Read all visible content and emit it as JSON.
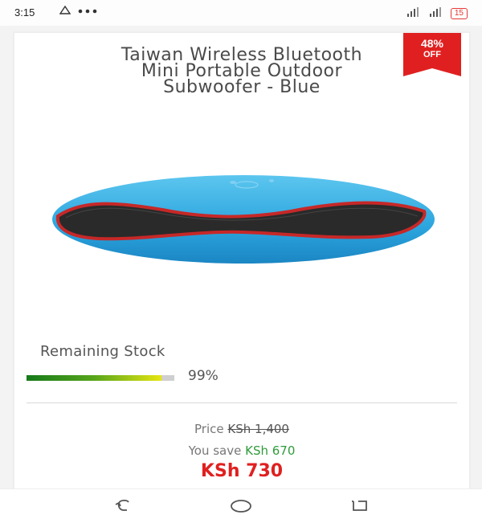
{
  "status_bar": {
    "time": "3:15",
    "left_icons": [
      "notification-icon",
      "more-dots-icon"
    ],
    "right_icons": [
      "signal-icon",
      "signal-icon"
    ],
    "battery": "15",
    "colors": {
      "battery": "#e53935"
    }
  },
  "product": {
    "title": "Taiwan Wireless Bluetooth Mini Portable Outdoor Subwoofer - Blue",
    "badge": {
      "pct": "48%",
      "off": "OFF",
      "color": "#e02020"
    },
    "image_icon": "speaker-image"
  },
  "stock": {
    "label": "Remaining Stock",
    "percent_text": "99%",
    "fill_fraction": 0.99
  },
  "pricing": {
    "price_label": "Price",
    "old_price": "KSh 1,400",
    "save_label": "You save",
    "save_amount": "KSh 670",
    "current_price": "KSh 730",
    "colors": {
      "current": "#e02020",
      "save": "#2e9b3a"
    }
  },
  "nav_bar": {
    "icons": [
      "back-icon",
      "home-icon",
      "recents-icon"
    ]
  }
}
